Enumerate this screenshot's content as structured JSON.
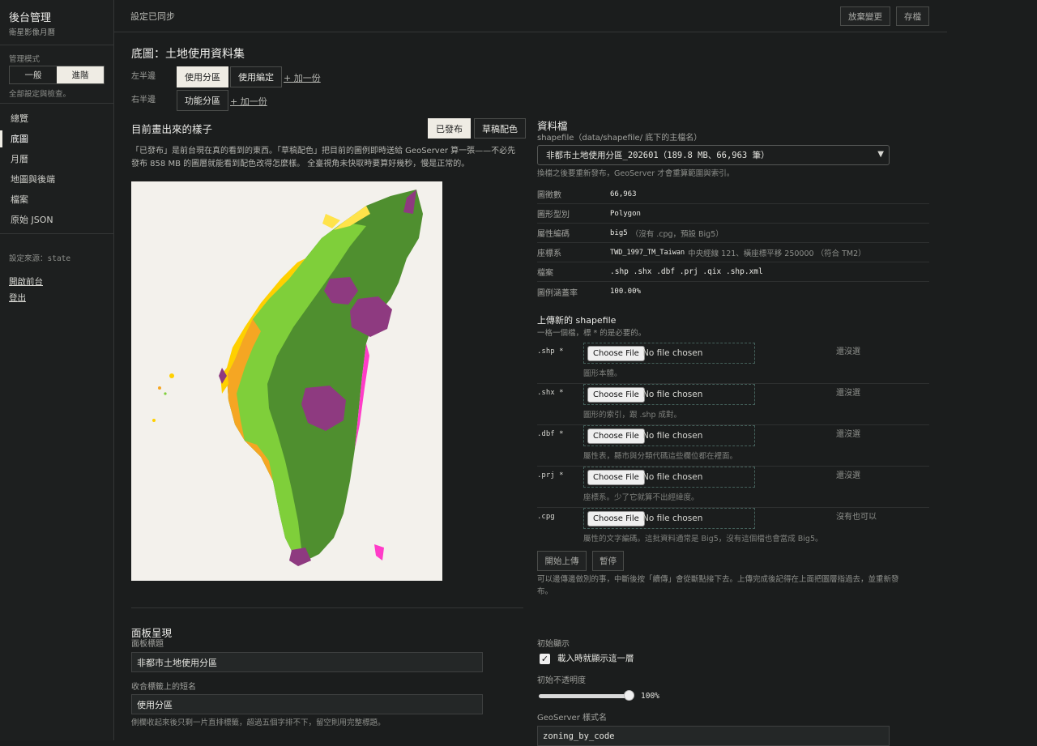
{
  "sidebar": {
    "title": "後台管理",
    "subtitle": "衛星影像月曆",
    "mode_label": "管理模式",
    "modes": [
      "一般",
      "進階"
    ],
    "active_mode": "進階",
    "mode_hint": "全部設定與檢查。",
    "nav": [
      "總覽",
      "底圖",
      "月曆",
      "地圖與後端",
      "檔案",
      "原始 JSON"
    ],
    "active_nav": "底圖",
    "source": "設定來源：state",
    "links": [
      "開啟前台",
      "登出"
    ]
  },
  "topbar": {
    "status": "設定已同步",
    "discard": "放棄變更",
    "save": "存檔"
  },
  "page": {
    "title": "底圖：土地使用資料集",
    "left_label": "左半邊",
    "left_chips": [
      "使用分區",
      "使用編定"
    ],
    "right_label": "右半邊",
    "right_chips": [
      "功能分區"
    ],
    "add_link": "+ 加一份"
  },
  "preview": {
    "title": "目前畫出來的樣子",
    "published": "已發布",
    "draft": "草稿配色",
    "desc_line1": "「已發布」是前台現在真的看到的東西。「草稿配色」把目前的圖例即時送給 GeoServer 算一張——不必先",
    "desc_line2": "發布 858 MB 的圖層就能看到配色改得怎麼樣。 全臺視角未快取時要算好幾秒，慢是正常的。"
  },
  "datafile": {
    "title": "資料檔",
    "hint": "shapefile（data/shapefile/ 底下的主檔名）",
    "selected": "非都市土地使用分區_202601（189.8 MB、66,963 筆）",
    "note": "換檔之後要重新發布，GeoServer 才會重算範圍與索引。",
    "rows": [
      {
        "k": "圖徵數",
        "v": "66,963",
        "extra": ""
      },
      {
        "k": "圖形型別",
        "v": "Polygon",
        "extra": ""
      },
      {
        "k": "屬性編碼",
        "v": "big5",
        "extra": "（沒有 .cpg，預設 Big5）"
      },
      {
        "k": "座標系",
        "v": "TWD_1997_TM_Taiwan",
        "extra": "中央經線 121、橫座標平移 250000 （符合 TM2）"
      },
      {
        "k": "檔案",
        "v": ".shp .shx .dbf .prj .qix .shp.xml",
        "extra": ""
      },
      {
        "k": "圖例涵蓋率",
        "v": "100.00%",
        "extra": ""
      }
    ]
  },
  "upload": {
    "title": "上傳新的 shapefile",
    "hint": "一格一個檔，標 * 的是必要的。",
    "choose": "Choose File",
    "no_file": "No file chosen",
    "rows": [
      {
        "ext": ".shp *",
        "hint": "圖形本體。",
        "status": "還沒選"
      },
      {
        "ext": ".shx *",
        "hint": "圖形的索引，跟 .shp 成對。",
        "status": "還沒選"
      },
      {
        "ext": ".dbf *",
        "hint": "屬性表，縣市與分類代碼這些欄位都在裡面。",
        "status": "還沒選"
      },
      {
        "ext": ".prj *",
        "hint": "座標系。少了它就算不出經緯度。",
        "status": "還沒選"
      },
      {
        "ext": ".cpg",
        "hint": "屬性的文字編碼。這批資料通常是 Big5，沒有這個檔也會當成 Big5。",
        "status": "沒有也可以"
      }
    ],
    "start": "開始上傳",
    "pause": "暫停",
    "note_line1": "可以邊傳邊做別的事，中斷後按「續傳」會從斷點接下去。上傳完成後記得在上面把圖層指過去，並重新發",
    "note_line2": "布。"
  },
  "panel": {
    "title": "面板呈現",
    "name_label": "面板標題",
    "name_value": "非都市土地使用分區",
    "short_label": "收合標籤上的短名",
    "short_value": "使用分區",
    "short_hint": "側欄收起來後只剩一片直排標籤，超過五個字排不下，留空則用完整標題。",
    "initial_label": "初始顯示",
    "initial_check": "載入時就顯示這一層",
    "initial_checked": true,
    "opacity_label": "初始不透明度",
    "opacity_value": "100%",
    "opacity": 1.0,
    "style_label": "GeoServer 樣式名",
    "style_value": "zoning_by_code"
  }
}
